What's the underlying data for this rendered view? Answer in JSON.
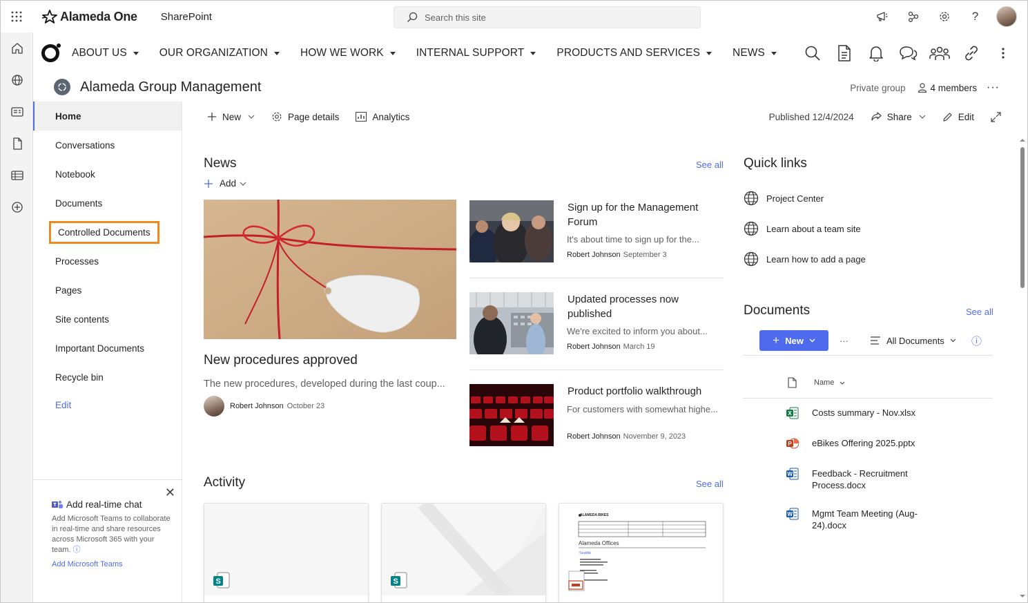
{
  "suite": {
    "brand": "Alameda One",
    "app": "SharePoint",
    "search_placeholder": "Search this site",
    "icons": [
      "megaphone-icon",
      "share-network-icon",
      "settings-icon",
      "help-icon",
      "avatar"
    ]
  },
  "hub_nav": {
    "items": [
      {
        "label": "ABOUT US"
      },
      {
        "label": "OUR ORGANIZATION"
      },
      {
        "label": "HOW WE WORK"
      },
      {
        "label": "INTERNAL SUPPORT"
      },
      {
        "label": "PRODUCTS AND SERVICES"
      },
      {
        "label": "NEWS"
      }
    ],
    "right_icons": [
      "search-icon",
      "document-icon",
      "bell-icon",
      "chat-icon",
      "people-icon",
      "link-icon",
      "more-icon"
    ]
  },
  "site": {
    "title": "Alameda Group Management",
    "privacy": "Private group",
    "members": "4 members"
  },
  "left_nav": {
    "items": [
      {
        "label": "Home",
        "active": true
      },
      {
        "label": "Conversations"
      },
      {
        "label": "Notebook"
      },
      {
        "label": "Documents"
      },
      {
        "label": "Controlled Documents",
        "highlighted": true
      },
      {
        "label": "Processes"
      },
      {
        "label": "Pages"
      },
      {
        "label": "Site contents"
      },
      {
        "label": "Important Documents"
      },
      {
        "label": "Recycle bin"
      }
    ],
    "edit_label": "Edit"
  },
  "chat_panel": {
    "title": "Add real-time chat",
    "description": "Add Microsoft Teams to collaborate in real-time and share resources across Microsoft 365 with your team.",
    "link": "Add Microsoft Teams"
  },
  "command_bar": {
    "new_label": "New",
    "page_details_label": "Page details",
    "analytics_label": "Analytics",
    "published": "Published 12/4/2024",
    "share_label": "Share",
    "edit_label": "Edit"
  },
  "news": {
    "title": "News",
    "see_all": "See all",
    "add_label": "Add",
    "hero": {
      "title": "New procedures approved",
      "description": "The new procedures, developed during the last coup...",
      "author": "Robert Johnson",
      "date": "October 23"
    },
    "items": [
      {
        "title": "Sign up for the Management Forum",
        "description": "It's about time to sign up for the...",
        "author": "Robert Johnson",
        "date": "September 3"
      },
      {
        "title": "Updated processes now published",
        "description": "We're excited to inform you about...",
        "author": "Robert Johnson",
        "date": "March 19"
      },
      {
        "title": "Product portfolio walkthrough",
        "description": "For customers with somewhat highe...",
        "author": "Robert Johnson",
        "date": "November 9, 2023"
      }
    ]
  },
  "activity": {
    "title": "Activity",
    "see_all": "See all",
    "doc_preview": {
      "brand": "ALAMEDA BIKES",
      "heading": "Alameda Offices",
      "city": "Seattle"
    }
  },
  "quick_links": {
    "title": "Quick links",
    "items": [
      {
        "label": "Project Center"
      },
      {
        "label": "Learn about a team site"
      },
      {
        "label": "Learn how to add a page"
      }
    ]
  },
  "documents": {
    "title": "Documents",
    "see_all": "See all",
    "new_label": "New",
    "more_label": "···",
    "view_label": "All Documents",
    "column_name": "Name",
    "files": [
      {
        "name": "Costs summary - Nov.xlsx",
        "type": "excel",
        "color": "#107c41"
      },
      {
        "name": "eBikes Offering 2025.pptx",
        "type": "powerpoint",
        "color": "#c43e1c"
      },
      {
        "name": "Feedback - Recruitment Process.docx",
        "type": "word",
        "color": "#185abd"
      },
      {
        "name": "Mgmt Team Meeting (Aug-24).docx",
        "type": "word",
        "color": "#185abd"
      }
    ]
  },
  "colors": {
    "accent": "#4f6bed",
    "highlight": "#f08a1c"
  }
}
